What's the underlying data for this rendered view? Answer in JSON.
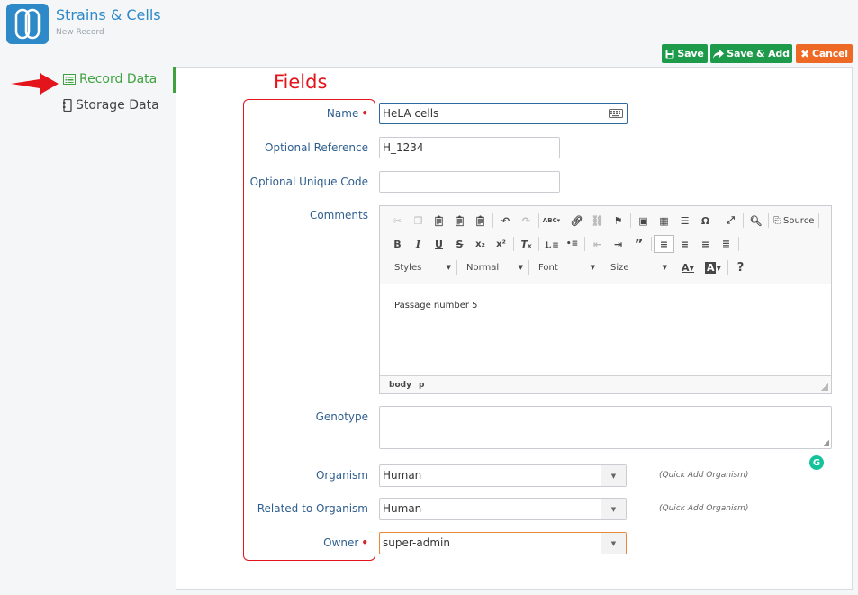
{
  "app": {
    "title": "Strains & Cells",
    "subtitle": "New Record"
  },
  "toolbar": {
    "save_label": "Save",
    "save_add_label": "Save & Add",
    "cancel_label": "Cancel"
  },
  "sidebar": {
    "items": [
      {
        "label": "Record Data",
        "icon": "list-icon",
        "active": true
      },
      {
        "label": "Storage Data",
        "icon": "freezer-icon",
        "active": false
      }
    ]
  },
  "annotation": {
    "fields_label": "Fields",
    "color": "#e3141b"
  },
  "form": {
    "name": {
      "label": "Name",
      "value": "HeLA cells",
      "required": true
    },
    "optional_reference": {
      "label": "Optional Reference",
      "value": "H_1234"
    },
    "optional_unique_code": {
      "label": "Optional Unique Code",
      "value": ""
    },
    "comments": {
      "label": "Comments",
      "content": "Passage number 5",
      "combos": [
        "Styles",
        "Normal",
        "Font",
        "Size"
      ],
      "source_label": "Source",
      "path": [
        "body",
        "p"
      ]
    },
    "genotype": {
      "label": "Genotype",
      "value": ""
    },
    "organism": {
      "label": "Organism",
      "value": "Human",
      "quick_add": "(Quick Add Organism)"
    },
    "related_organism": {
      "label": "Related to Organism",
      "value": "Human",
      "quick_add": "(Quick Add Organism)"
    },
    "owner": {
      "label": "Owner",
      "value": "super-admin",
      "required": true
    }
  },
  "colors": {
    "brand": "#2d89c8",
    "save": "#1e9a4b",
    "cancel": "#ee6a24",
    "active_nav": "#3fa23f",
    "label": "#2f5f8f"
  }
}
